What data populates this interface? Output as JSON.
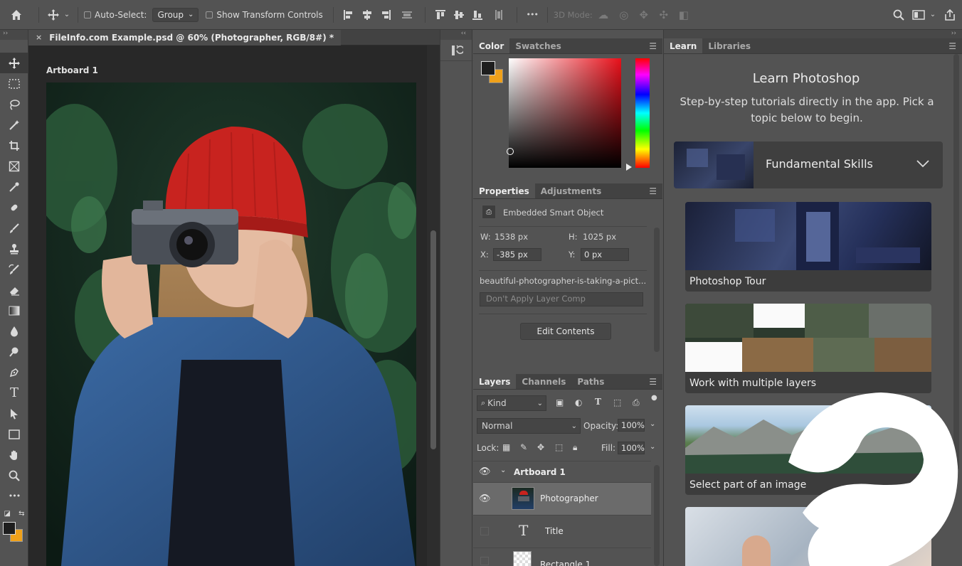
{
  "options_bar": {
    "auto_select_label": "Auto-Select:",
    "auto_select_value": "Group",
    "transform_label": "Show Transform Controls",
    "mode_3d_label": "3D Mode:",
    "more_glyph": "•••"
  },
  "toolbar": {
    "tools": [
      "move-tool",
      "marquee-tool",
      "lasso-tool",
      "magic-wand-tool",
      "crop-tool",
      "frame-tool",
      "eyedropper-tool",
      "healing-brush-tool",
      "brush-tool",
      "clone-stamp-tool",
      "history-brush-tool",
      "eraser-tool",
      "gradient-tool",
      "blur-tool",
      "dodge-tool",
      "pen-tool",
      "type-tool",
      "path-selection-tool",
      "rectangle-tool",
      "hand-tool",
      "zoom-tool",
      "edit-toolbar"
    ],
    "type_glyph": "T",
    "more_glyph": "•••"
  },
  "document": {
    "tab_title": "FileInfo.com Example.psd @ 60% (Photographer, RGB/8#) *",
    "close_glyph": "×",
    "artboard_label": "Artboard 1"
  },
  "collapsed": {
    "collapse_glyph": "‹‹"
  },
  "color_panel": {
    "tabs": [
      "Color",
      "Swatches"
    ],
    "foreground": "#1e1e1e",
    "background": "#f0a11a"
  },
  "properties_panel": {
    "tabs": [
      "Properties",
      "Adjustments"
    ],
    "type_label": "Embedded Smart Object",
    "w_label": "W:",
    "w_value": "1538 px",
    "h_label": "H:",
    "h_value": "1025 px",
    "x_label": "X:",
    "x_value": "-385 px",
    "y_label": "Y:",
    "y_value": "0 px",
    "filename": "beautiful-photographer-is-taking-a-pict...",
    "layer_comp_placeholder": "Don't Apply Layer Comp",
    "edit_button": "Edit Contents"
  },
  "layers_panel": {
    "tabs": [
      "Layers",
      "Channels",
      "Paths"
    ],
    "filter_kind": "Kind",
    "blend_mode": "Normal",
    "opacity_label": "Opacity:",
    "opacity_value": "100%",
    "lock_label": "Lock:",
    "fill_label": "Fill:",
    "fill_value": "100%",
    "layers": [
      {
        "name": "Artboard 1",
        "type": "artboard"
      },
      {
        "name": "Photographer",
        "type": "smart-object",
        "selected": true
      },
      {
        "name": "Title",
        "type": "text"
      },
      {
        "name": "Rectangle 1",
        "type": "shape"
      }
    ]
  },
  "learn_panel": {
    "tabs": [
      "Learn",
      "Libraries"
    ],
    "title": "Learn Photoshop",
    "subtitle": "Step-by-step tutorials directly in the app. Pick a topic below to begin.",
    "section": "Fundamental Skills",
    "cards": [
      "Photoshop Tour",
      "Work with multiple layers",
      "Select part of an image"
    ]
  },
  "colors": {
    "ui_bg": "#535353",
    "panel_dark": "#424242",
    "accent_yellow": "#f0a11a",
    "hat_red": "#c8231f"
  }
}
